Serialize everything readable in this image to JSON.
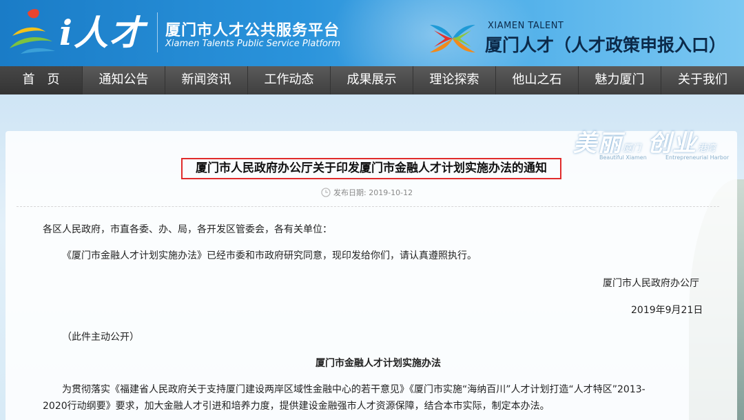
{
  "header": {
    "logo_text": "i人才",
    "site_title": "厦门市人才公共服务平台",
    "site_subtitle": "Xiamen Talents Public Service Platform",
    "xt_en": "XIAMEN TALENT",
    "xt_cn": "厦门人才（人才政策申报入口）"
  },
  "nav": [
    {
      "label": "首　页"
    },
    {
      "label": "通知公告"
    },
    {
      "label": "新闻资讯"
    },
    {
      "label": "工作动态"
    },
    {
      "label": "成果展示"
    },
    {
      "label": "理论探索"
    },
    {
      "label": "他山之石"
    },
    {
      "label": "魅力厦门"
    },
    {
      "label": "关于我们"
    }
  ],
  "deco": {
    "a": "美丽",
    "a_small": "厦门",
    "b": "创业",
    "b_small": "港湾",
    "a_en": "Beautiful Xiamen",
    "b_en": "Entrepreneurial Harbor"
  },
  "article": {
    "title": "厦门市人民政府办公厅关于印发厦门市金融人才计划实施办法的通知",
    "date_label": "发布日期: 2019-10-12",
    "salutation": "各区人民政府，市直各委、办、局，各开发区管委会，各有关单位：",
    "body1": "《厦门市金融人才计划实施办法》已经市委和市政府研究同意，现印发给你们，请认真遵照执行。",
    "signer": "厦门市人民政府办公厅",
    "sign_date": "2019年9月21日",
    "public_note": "（此件主动公开）",
    "sub_title": "厦门市金融人才计划实施办法",
    "body2_line1": "为贯彻落实《福建省人民政府关于支持厦门建设两岸区域性金融中心的若干意见》《厦门市实施“海纳百川”人才计划打造“人才特区”2013-",
    "body2_line2": "2020行动纲要》要求，加大金融人才引进和培养力度，提供建设金融强市人才资源保障，结合本市实际，制定本办法。"
  }
}
